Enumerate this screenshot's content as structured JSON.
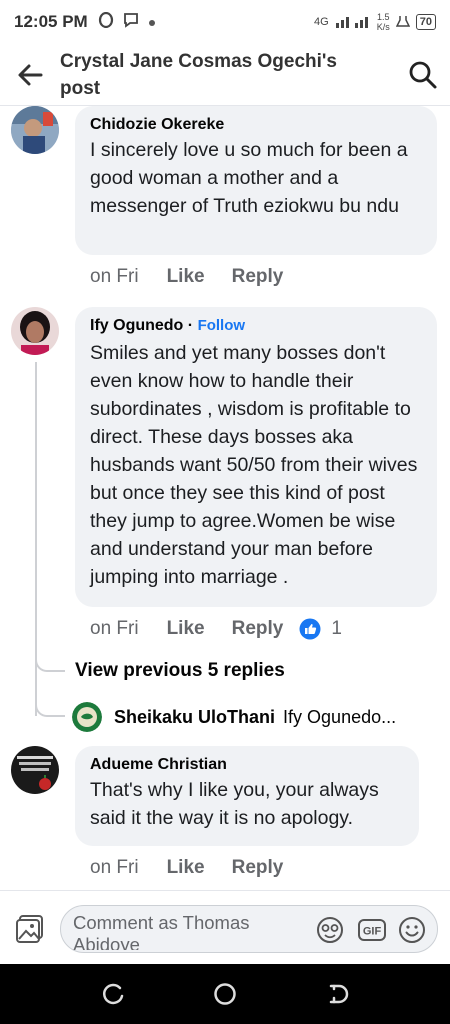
{
  "status_bar": {
    "time": "12:05 PM",
    "network": "4G",
    "speed": "1.5",
    "speed_unit": "K/s",
    "battery": "70"
  },
  "header": {
    "title": "Crystal Jane Cosmas Ogechi's post"
  },
  "comments": [
    {
      "author": "Chidozie Okereke",
      "text": "I sincerely  love u so much for been a good woman a mother and a messenger of Truth eziokwu bu ndu",
      "time": "on Fri",
      "like_label": "Like",
      "reply_label": "Reply"
    },
    {
      "author": "Ify Ogunedo",
      "follow_label": "Follow",
      "text": "Smiles and yet many bosses don't even know how to handle their subordinates , wisdom is profitable to direct. These days bosses aka husbands want 50/50 from their wives but once they see this kind of post they jump to agree.Women be wise and understand your man before jumping into marriage .",
      "time": "on Fri",
      "like_label": "Like",
      "reply_label": "Reply",
      "reaction_count": "1",
      "view_replies_label": "View previous 5 replies",
      "reply_preview": {
        "author": "Sheikaku UloThani",
        "text": "Ify Ogunedo..."
      }
    },
    {
      "author": "Adueme Christian",
      "text": "That's why I like you,  your always said it the way it is no apology.",
      "time": "on Fri",
      "like_label": "Like",
      "reply_label": "Reply"
    }
  ],
  "composer": {
    "placeholder": "Comment as Thomas Abidoye",
    "gif_label": "GIF"
  },
  "colors": {
    "accent": "#1877f2",
    "bubble": "#f0f2f5",
    "secondary_text": "#65676b"
  }
}
